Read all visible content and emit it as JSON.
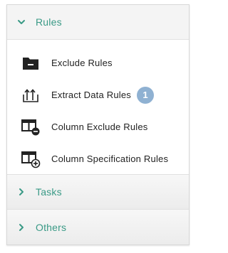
{
  "accordion": {
    "sections": [
      {
        "label": "Rules",
        "expanded": true,
        "items": [
          {
            "label": "Exclude Rules",
            "icon": "folder-minus-icon"
          },
          {
            "label": "Extract Data Rules",
            "icon": "export-upload-icon",
            "badge": "1"
          },
          {
            "label": "Column Exclude Rules",
            "icon": "column-minus-icon"
          },
          {
            "label": "Column Specification Rules",
            "icon": "column-plus-icon"
          }
        ]
      },
      {
        "label": "Tasks",
        "expanded": false
      },
      {
        "label": "Others",
        "expanded": false
      }
    ]
  },
  "colors": {
    "accent": "#3a9a86",
    "badge": "#8fb1d2",
    "icon": "#222222"
  }
}
